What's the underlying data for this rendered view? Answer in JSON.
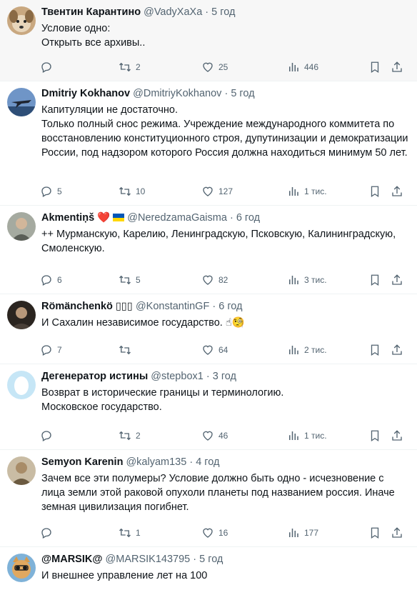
{
  "tweets": [
    {
      "name": "Твентин Карантино",
      "handle": "@VadyXaXa",
      "time": "5 год",
      "text": "Условие одно:\nОткрыть все архивы..",
      "reply": "",
      "retweet": "2",
      "like": "25",
      "views": "446",
      "avatar_color": "#c2a27a"
    },
    {
      "name": "Dmitriy Kokhanov",
      "handle": "@DmitriyKokhanov",
      "time": "5 год",
      "text": "Капитуляции не достаточно.\nТолько полный снос режима. Учреждение международного коммитета по восстановлению конституционного строя, дупутинизации и демократизации России, под надзором которого Россия должна находиться минимум 50 лет.",
      "reply": "5",
      "retweet": "10",
      "like": "127",
      "views": "1 тис.",
      "avatar_color": "#4a6c9b"
    },
    {
      "name": "Akmentiņš",
      "name_emoji": "❤️",
      "handle": "@NeredzamaGaisma",
      "time": "6 год",
      "text": "++ Мурманскую, Карелию, Ленинградскую, Псковскую, Калининградскую, Смоленскую.",
      "reply": "6",
      "retweet": "5",
      "like": "82",
      "views": "3 тис.",
      "avatar_color": "#8b8f86"
    },
    {
      "name": "Römänchenkö",
      "name_suffix": "▯▯▯",
      "handle": "@KonstantinGF",
      "time": "6 год",
      "text": "И Сахалин независимое государство. ☝🧐",
      "reply": "7",
      "retweet": "",
      "like": "64",
      "views": "2 тис.",
      "avatar_color": "#3b342d"
    },
    {
      "name": "Дегенератор истины",
      "handle": "@stepbox1",
      "time": "3 год",
      "text": "Возврат в исторические границы и терминологию.\nМосковское государство.",
      "reply": "",
      "retweet": "2",
      "like": "46",
      "views": "1 тис.",
      "avatar_color": "#bfe3f5"
    },
    {
      "name": "Semyon Karenin",
      "handle": "@kalyam135",
      "time": "4 год",
      "text": "Зачем все эти полумеры? Условие должно быть одно - исчезновение с лица земли этой раковой опухоли планеты под названием россия. Иначе земная цивилизация погибнет.",
      "reply": "",
      "retweet": "1",
      "like": "16",
      "views": "177",
      "avatar_color": "#9d8b6e"
    },
    {
      "name": "@MARSIK@",
      "handle": "@MARSIK143795",
      "time": "5 год",
      "text": "И внешнее управление лет на 100",
      "reply": "",
      "retweet": "",
      "like": "",
      "views": "",
      "avatar_color": "#d99a4a"
    }
  ],
  "separator": "·",
  "icons": {
    "reply": "reply-icon",
    "retweet": "retweet-icon",
    "like": "heart-icon",
    "views": "views-icon",
    "bookmark": "bookmark-icon",
    "share": "share-icon"
  },
  "colors": {
    "retweet_hover": "#00ba7c",
    "text_secondary": "#536471",
    "flag_blue": "#0057b7",
    "flag_yellow": "#ffd700"
  }
}
